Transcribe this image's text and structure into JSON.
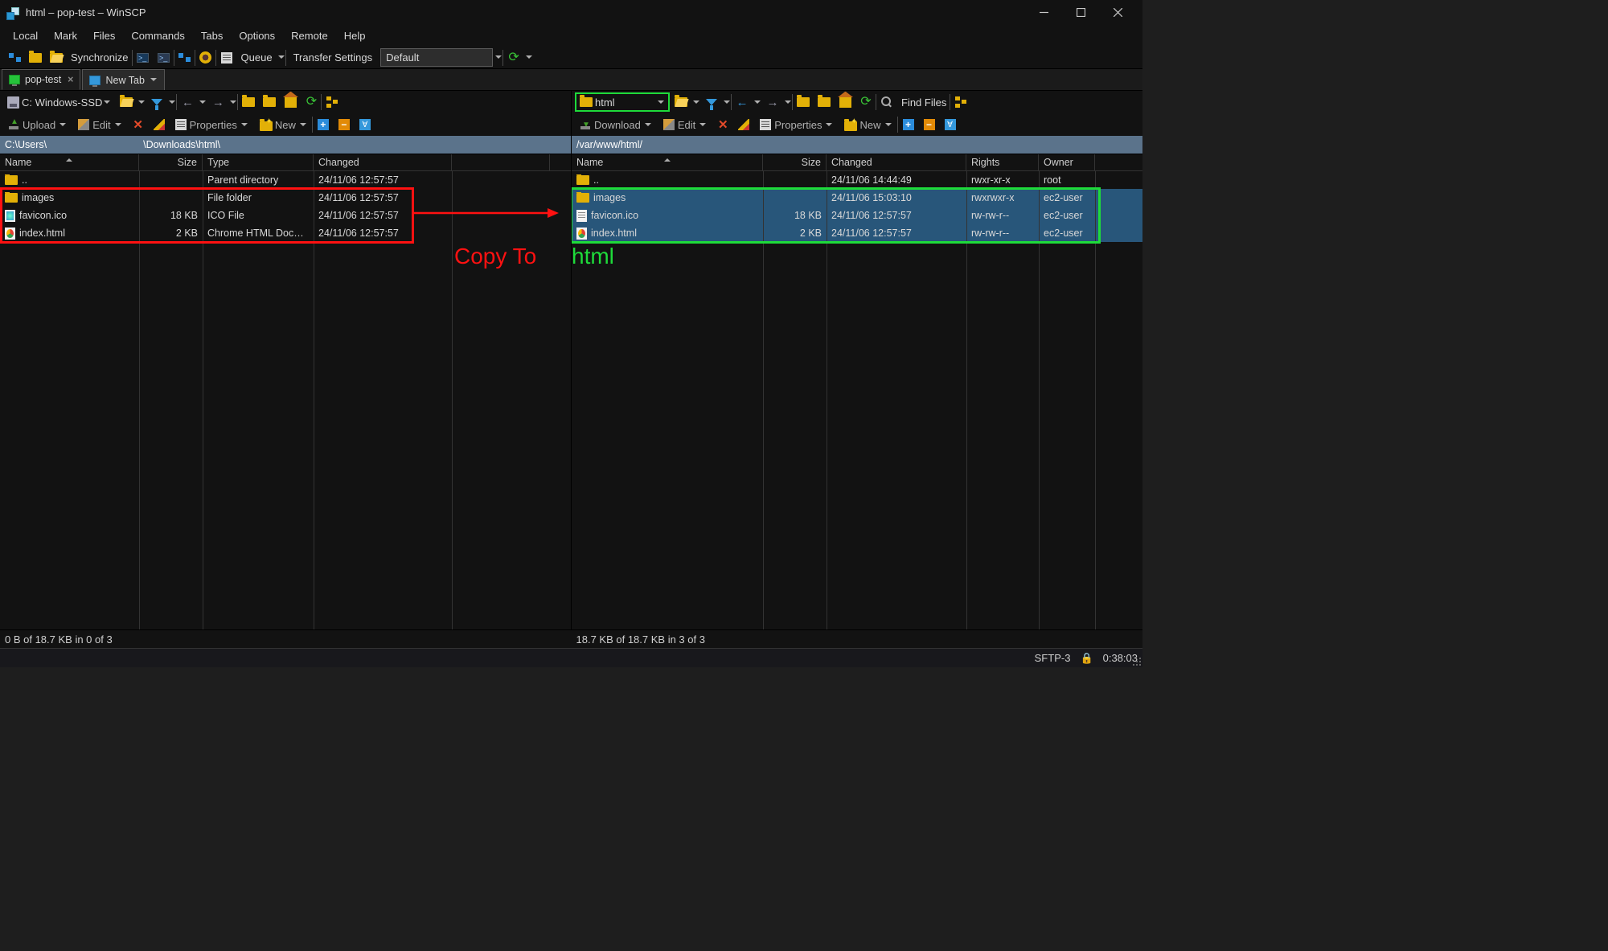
{
  "window": {
    "title": "html – pop-test – WinSCP"
  },
  "menubar": [
    "Local",
    "Mark",
    "Files",
    "Commands",
    "Tabs",
    "Options",
    "Remote",
    "Help"
  ],
  "maintoolbar": {
    "synchronize": "Synchronize",
    "queue": "Queue",
    "transfer_label": "Transfer Settings",
    "transfer_value": "Default"
  },
  "tabs": [
    {
      "label": "pop-test",
      "active": true,
      "closeable": true
    },
    {
      "label": "New Tab",
      "active": false,
      "closeable": false
    }
  ],
  "panel_left": {
    "drive": "C: Windows-SSD",
    "actions": {
      "upload": "Upload",
      "edit": "Edit",
      "properties": "Properties",
      "new": "New"
    },
    "path": "C:\\Users\\                         \\Downloads\\html\\",
    "columns": [
      "Name",
      "Size",
      "Type",
      "Changed"
    ],
    "rows": [
      {
        "name": "..",
        "icon": "up",
        "size": "",
        "type": "Parent directory",
        "changed": "24/11/06 12:57:57"
      },
      {
        "name": "images",
        "icon": "folder",
        "size": "",
        "type": "File folder",
        "changed": "24/11/06 12:57:57"
      },
      {
        "name": "favicon.ico",
        "icon": "ico",
        "size": "18 KB",
        "type": "ICO File",
        "changed": "24/11/06 12:57:57"
      },
      {
        "name": "index.html",
        "icon": "chrome",
        "size": "2 KB",
        "type": "Chrome HTML Doc…",
        "changed": "24/11/06 12:57:57"
      }
    ],
    "status": "0 B of 18.7 KB in 0 of 3"
  },
  "panel_right": {
    "drive": "html",
    "find_files": "Find Files",
    "actions": {
      "download": "Download",
      "edit": "Edit",
      "properties": "Properties",
      "new": "New"
    },
    "path": "/var/www/html/",
    "columns": [
      "Name",
      "Size",
      "Changed",
      "Rights",
      "Owner"
    ],
    "rows": [
      {
        "name": "..",
        "icon": "up",
        "size": "",
        "changed": "24/11/06 14:44:49",
        "rights": "rwxr-xr-x",
        "owner": "root",
        "sel": false
      },
      {
        "name": "images",
        "icon": "folder",
        "size": "",
        "changed": "24/11/06 15:03:10",
        "rights": "rwxrwxr-x",
        "owner": "ec2-user",
        "sel": true
      },
      {
        "name": "favicon.ico",
        "icon": "doc",
        "size": "18 KB",
        "changed": "24/11/06 12:57:57",
        "rights": "rw-rw-r--",
        "owner": "ec2-user",
        "sel": true
      },
      {
        "name": "index.html",
        "icon": "chrome",
        "size": "2 KB",
        "changed": "24/11/06 12:57:57",
        "rights": "rw-rw-r--",
        "owner": "ec2-user",
        "sel": true
      }
    ],
    "status": "18.7 KB of 18.7 KB in 3 of 3"
  },
  "annotations": {
    "copy_to": "Copy To",
    "html": "html"
  },
  "statusbar": {
    "protocol": "SFTP-3",
    "time": "0:38:03"
  }
}
